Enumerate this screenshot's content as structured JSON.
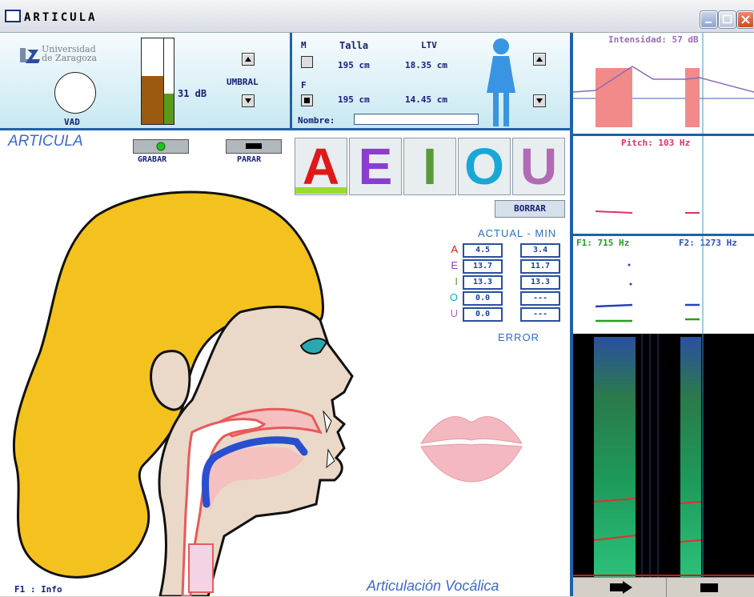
{
  "window": {
    "title": "ARTICULA"
  },
  "top": {
    "logo": {
      "line1": "Universidad",
      "line2": "de Zaragoza"
    },
    "vad_label": "VAD",
    "db_value": "31 dB",
    "umbral_label": "UMBRAL",
    "m_label": "M",
    "f_label": "F",
    "talla_header": "Talla",
    "ltv_header": "LTV",
    "m_talla": "195 cm",
    "m_ltv": "18.35 cm",
    "f_talla": "195 cm",
    "f_ltv": "14.45 cm",
    "nombre_label": "Nombre:",
    "nombre_value": ""
  },
  "main": {
    "title": "ARTICULA",
    "grabar": "GRABAR",
    "parar": "PARAR",
    "vowels": [
      "A",
      "E",
      "I",
      "O",
      "U"
    ],
    "borrar": "BORRAR",
    "table_header": "ACTUAL - MIN",
    "table_footer": "ERROR",
    "rows": [
      {
        "v": "A",
        "actual": "4.5",
        "min": "3.4"
      },
      {
        "v": "E",
        "actual": "13.7",
        "min": "11.7"
      },
      {
        "v": "I",
        "actual": "13.3",
        "min": "13.3"
      },
      {
        "v": "O",
        "actual": "0.0",
        "min": "---"
      },
      {
        "v": "U",
        "actual": "0.0",
        "min": "---"
      }
    ],
    "footer_left": "F1 : Info",
    "footer_right": "Articulación Vocálica"
  },
  "right": {
    "intensidad": "Intensidad: 57 dB",
    "pitch": "Pitch: 103 Hz",
    "f1": "F1: 715 Hz",
    "f2": "F2: 1273 Hz"
  },
  "colors": {
    "blue": "#1f62aa",
    "A": "#e01818",
    "E": "#8a3ed0",
    "I": "#5a9a3a",
    "O": "#19a8d6",
    "U": "#b26ab4"
  }
}
